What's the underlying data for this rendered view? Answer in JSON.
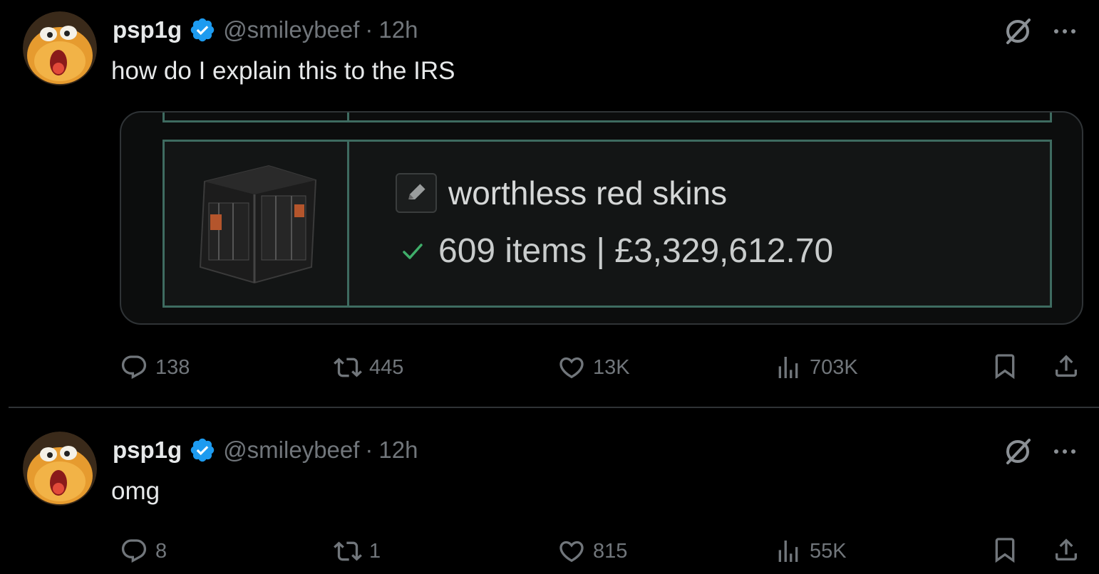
{
  "tweets": [
    {
      "author": {
        "name": "psp1g",
        "handle": "@smileybeef",
        "verified": true
      },
      "separator": "·",
      "time": "12h",
      "text": "how do I explain this to the IRS",
      "media": {
        "inventory_name": "worthless red skins",
        "inventory_stats": "609 items | £3,329,612.70"
      },
      "stats": {
        "replies": "138",
        "reposts": "445",
        "likes": "13K",
        "views": "703K"
      }
    },
    {
      "author": {
        "name": "psp1g",
        "handle": "@smileybeef",
        "verified": true
      },
      "separator": "·",
      "time": "12h",
      "text": "omg",
      "stats": {
        "replies": "8",
        "reposts": "1",
        "likes": "815",
        "views": "55K"
      }
    }
  ],
  "colors": {
    "background": "#000000",
    "text_primary": "#e7e9ea",
    "text_secondary": "#71767b",
    "verified_blue": "#1d9bf0",
    "panel_border": "#3e6b60",
    "check_green": "#3fae6a"
  },
  "icons": {
    "avatar": "avatar-image",
    "verified": "verified-badge-icon",
    "grok": "grok-icon",
    "more": "more-icon",
    "reply": "reply-icon",
    "repost": "repost-icon",
    "like": "like-icon",
    "views": "views-icon",
    "bookmark": "bookmark-icon",
    "share": "share-icon",
    "edit": "pencil-icon",
    "check": "check-icon"
  }
}
